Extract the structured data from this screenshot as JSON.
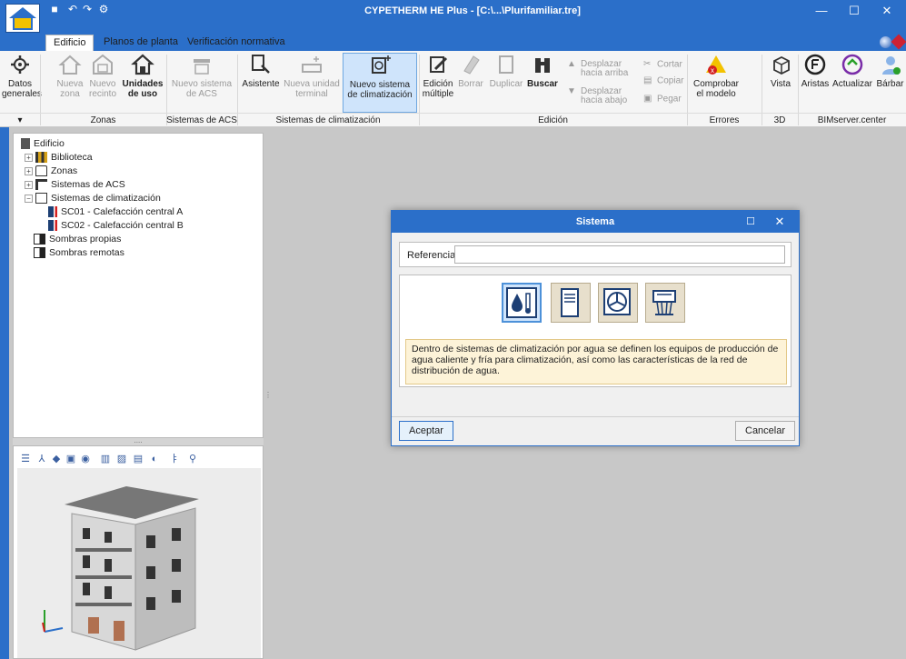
{
  "window": {
    "title": "CYPETHERM HE Plus - [C:\\...\\Plurifamiliar.tre]",
    "minimize": "—",
    "maximize": "☐",
    "close": "✕"
  },
  "menu_tabs": [
    "Edificio",
    "Planos de planta",
    "Verificación normativa"
  ],
  "ribbon": {
    "buttons": {
      "datos_generales": "Datos\ngenerales",
      "nueva_zona": "Nueva\nzona",
      "nuevo_recinto": "Nuevo\nrecinto",
      "unidades_de_uso": "Unidades\nde uso",
      "nuevo_sistema_acs": "Nuevo sistema\nde ACS",
      "asistente": "Asistente",
      "nueva_unidad_terminal": "Nueva unidad\nterminal",
      "nuevo_sistema_climatizacion": "Nuevo sistema\nde climatización",
      "edicion_multiple": "Edición\nmúltiple",
      "borrar": "Borrar",
      "duplicar": "Duplicar",
      "buscar": "Buscar",
      "desplazar_arriba": "Desplazar\nhacia arriba",
      "desplazar_abajo": "Desplazar\nhacia abajo",
      "cortar": "Cortar",
      "copiar": "Copiar",
      "pegar": "Pegar",
      "comprobar_modelo": "Comprobar\nel modelo",
      "vista": "Vista",
      "aristas": "Aristas",
      "actualizar": "Actualizar",
      "barbar": "Bárbar"
    },
    "groups": {
      "zonas": "Zonas",
      "sistemas_acs": "Sistemas de ACS",
      "sistemas_climatizacion": "Sistemas de climatización",
      "edicion": "Edición",
      "errores": "Errores",
      "tres_d": "3D",
      "bimserver": "BIMserver.center"
    }
  },
  "tree": {
    "root": "Edificio",
    "items": [
      {
        "label": "Biblioteca",
        "icon": "library-icon"
      },
      {
        "label": "Zonas",
        "icon": "house-outline-icon"
      },
      {
        "label": "Sistemas de ACS",
        "icon": "faucet-icon"
      },
      {
        "label": "Sistemas de climatización",
        "icon": "hvac-icon"
      },
      {
        "label": "SC01 - Calefacción central A",
        "icon": "water-thermometer-icon"
      },
      {
        "label": "SC02 - Calefacción central B",
        "icon": "water-thermometer-icon"
      },
      {
        "label": "Sombras propias",
        "icon": "shadow-icon"
      },
      {
        "label": "Sombras remotas",
        "icon": "shadow-icon"
      }
    ]
  },
  "dialog": {
    "title": "Sistema",
    "reference_label": "Referencia",
    "reference_value": "",
    "description": "Dentro de sistemas de climatización por agua se definen los equipos de producción de agua caliente y fría para climatización, así como las características de la red de distribución de agua.",
    "accept": "Aceptar",
    "cancel": "Cancelar",
    "system_types": [
      {
        "icon": "water-thermometer-icon",
        "selected": true
      },
      {
        "icon": "unit-cabinet-icon",
        "selected": false
      },
      {
        "icon": "fan-unit-icon",
        "selected": false
      },
      {
        "icon": "ducted-unit-icon",
        "selected": false
      }
    ]
  },
  "colors": {
    "accent": "#2b6fc9",
    "selected_bg": "#cfe4fb",
    "info_bg": "#fdf3d8"
  }
}
